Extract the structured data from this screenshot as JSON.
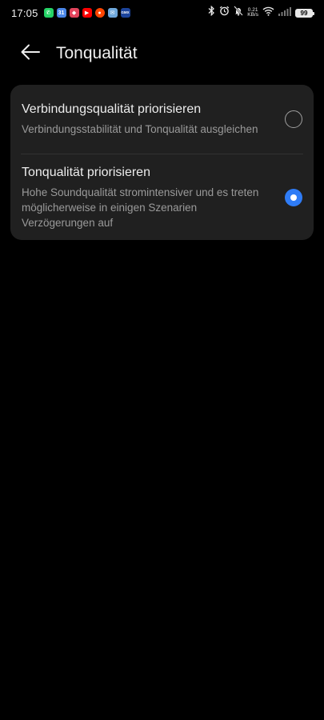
{
  "status_bar": {
    "time": "17:05",
    "notification_icons": [
      {
        "name": "whatsapp-icon",
        "color": "#25d366",
        "glyph": "✆"
      },
      {
        "name": "calendar-icon",
        "color": "#4a86e8",
        "glyph": "31"
      },
      {
        "name": "shield-app-icon",
        "color": "#e2445c",
        "glyph": "◆"
      },
      {
        "name": "youtube-icon",
        "color": "#ff0000",
        "glyph": "▶"
      },
      {
        "name": "reddit-icon",
        "color": "#ff4500",
        "glyph": "●"
      },
      {
        "name": "mail-icon",
        "color": "#6fa8dc",
        "glyph": "✉"
      },
      {
        "name": "gmx-icon",
        "color": "#1c449b",
        "glyph": "GMX"
      }
    ],
    "net_speed_value": "0.21",
    "net_speed_unit": "KB/s",
    "battery_level": "99"
  },
  "header": {
    "title": "Tonqualität"
  },
  "options": [
    {
      "title": "Verbindungsqualität priorisieren",
      "description": "Verbindungsstabilität und Tonqualität ausgleichen",
      "selected": false
    },
    {
      "title": "Tonqualität priorisieren",
      "description": "Hohe Soundqualität stromintensiver und es treten möglicherweise in einigen Szenarien Verzögerungen auf",
      "selected": true
    }
  ],
  "colors": {
    "background": "#000000",
    "card": "#202020",
    "accent": "#2f7cf6",
    "text_primary": "#ececec",
    "text_secondary": "#9a9a9a"
  }
}
